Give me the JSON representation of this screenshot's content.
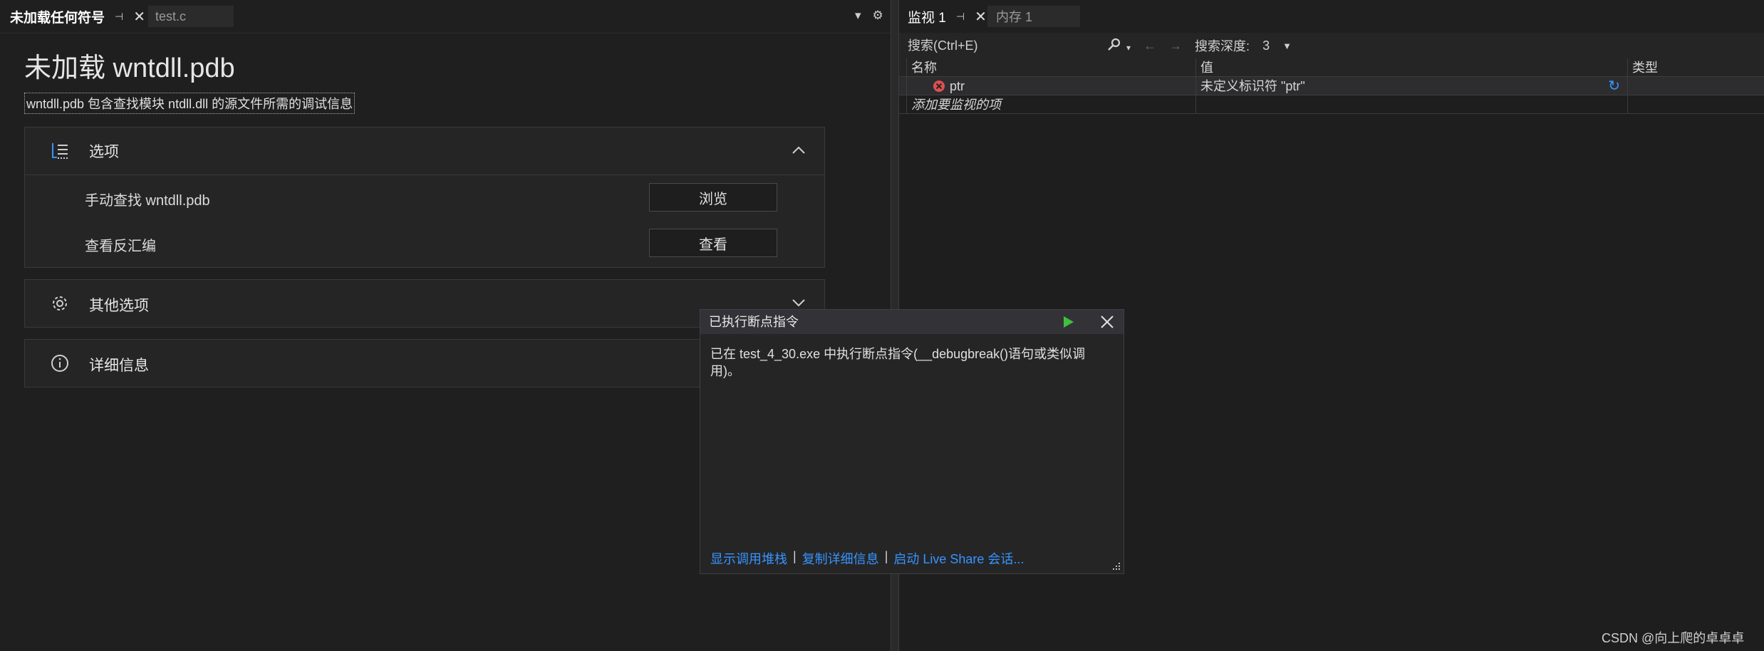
{
  "left_tabs": {
    "active_label": "未加载任何符号",
    "inactive_label": "test.c"
  },
  "symbols_page": {
    "title": "未加载 wntdll.pdb",
    "description": "wntdll.pdb 包含查找模块 ntdll.dll 的源文件所需的调试信息",
    "options": {
      "label": "选项",
      "rows": [
        {
          "label": "手动查找 wntdll.pdb",
          "button": "浏览"
        },
        {
          "label": "查看反汇编",
          "button": "查看"
        }
      ]
    },
    "other_options": {
      "label": "其他选项"
    },
    "details": {
      "label": "详细信息"
    }
  },
  "right_tabs": {
    "active_label": "监视 1",
    "inactive_label": "内存 1"
  },
  "watch": {
    "search_placeholder": "搜索(Ctrl+E)",
    "depth_label": "搜索深度:",
    "depth_value": "3",
    "columns": {
      "name": "名称",
      "value": "值",
      "type": "类型"
    },
    "rows": [
      {
        "name": "ptr",
        "value": "未定义标识符 \"ptr\"",
        "type": ""
      }
    ],
    "add_placeholder": "添加要监视的项"
  },
  "exception_popup": {
    "title": "已执行断点指令",
    "message": "已在 test_4_30.exe 中执行断点指令(__debugbreak()语句或类似调用)。",
    "links": [
      "显示调用堆栈",
      "复制详细信息",
      "启动 Live Share 会话..."
    ]
  },
  "watermark": "CSDN @向上爬的卓卓卓",
  "colors": {
    "background": "#1e1e1e",
    "link": "#3794ff",
    "error": "#e05050",
    "play": "#3fbf3f"
  }
}
